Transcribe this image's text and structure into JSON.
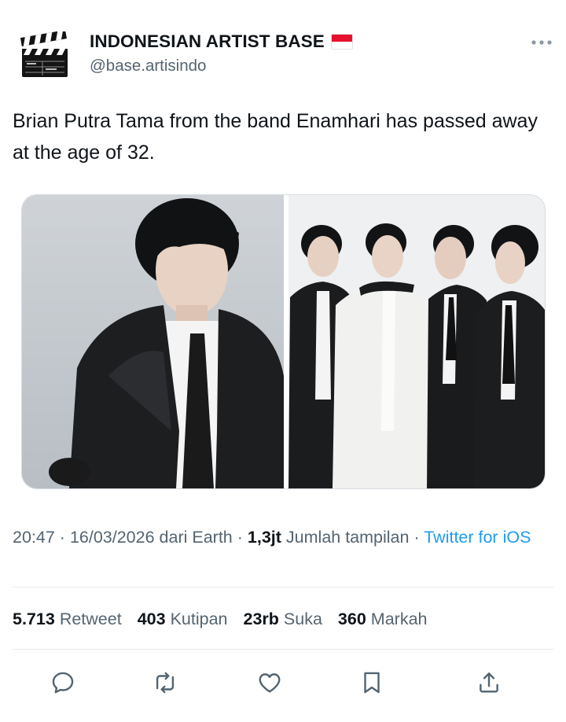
{
  "tweet": {
    "author": {
      "display_name": "INDONESIAN ARTIST BASE",
      "handle": "@base.artisindo",
      "avatar_icon": "clapperboard-icon",
      "flag_icon": "indonesia-flag-icon"
    },
    "text": "Brian Putra Tama from the band Enamhari has passed away at the age of 32.",
    "media": [
      {
        "name": "portrait-photo",
        "description_icon": "photo"
      },
      {
        "name": "group-photo",
        "description_icon": "photo"
      }
    ],
    "meta": {
      "time": "20:47",
      "date": "16/03/2026",
      "source_prefix": "dari Earth",
      "views_count": "1,3jt",
      "views_label": "Jumlah tampilan",
      "client": "Twitter for iOS"
    },
    "stats": [
      {
        "count": "5.713",
        "label": "Retweet"
      },
      {
        "count": "403",
        "label": "Kutipan"
      },
      {
        "count": "23rb",
        "label": "Suka"
      },
      {
        "count": "360",
        "label": "Markah"
      }
    ],
    "actions": [
      "reply-icon",
      "retweet-icon",
      "like-icon",
      "bookmark-icon",
      "share-icon"
    ]
  },
  "colors": {
    "text": "#0f1419",
    "secondary": "#536471",
    "link": "#1d9bf0",
    "divider": "#e6e9eb"
  }
}
